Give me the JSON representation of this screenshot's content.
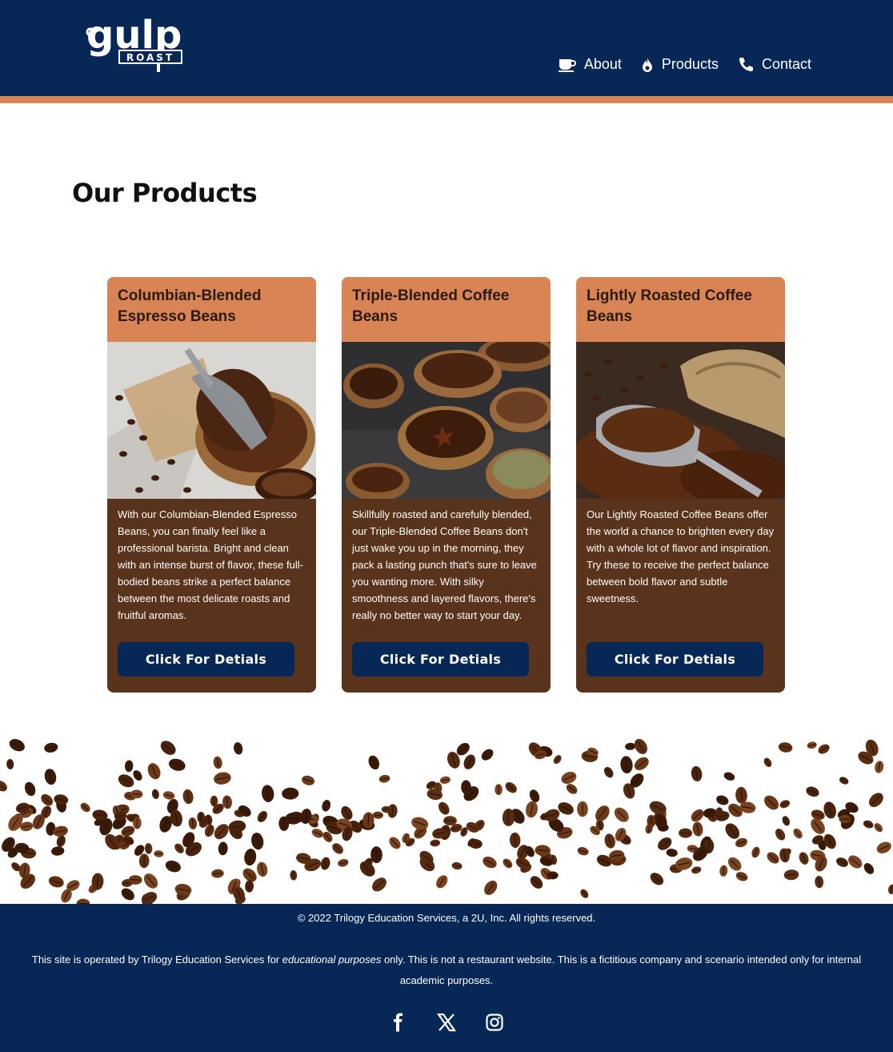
{
  "header": {
    "logo_text": "gulp",
    "logo_subtext": "ROAST",
    "nav": [
      {
        "label": "About",
        "icon": "coffee-cup-icon"
      },
      {
        "label": "Products",
        "icon": "flame-icon"
      },
      {
        "label": "Contact",
        "icon": "phone-icon"
      }
    ]
  },
  "main": {
    "title": "Our Products",
    "cards": [
      {
        "title": "Columbian-Blended Espresso Beans",
        "image": "coffee-beans-scoop-image",
        "description": "With our Columbian-Blended Espresso Beans, you can finally feel like a professional barista. Bright and clean with an intense burst of flavor, these full-bodied beans strike a perfect balance between the most delicate roasts and fruitful aromas.",
        "button": "Click For Detials"
      },
      {
        "title": "Triple-Blended Coffee Beans",
        "image": "coffee-bowls-image",
        "description": "Skillfully roasted and carefully blended, our Triple-Blended Coffee Beans don't just wake you up in the morning, they pack a lasting punch that's sure to leave you wanting more. With silky smoothness and layered flavors, there's really no better way to start your day.",
        "button": "Click For Detials"
      },
      {
        "title": "Lightly Roasted Coffee Beans",
        "image": "coffee-sack-scoop-image",
        "description": "Our Lightly Roasted Coffee Beans offer the world a chance to brighten every day with a whole lot of flavor and inspiration. Try these to receive the perfect balance between bold flavor and subtle sweetness.",
        "button": "Click For Detials"
      }
    ]
  },
  "footer": {
    "copyright": "© 2022 Trilogy Education Services, a 2U, Inc. All rights reserved.",
    "disclaimer_before": "This site is operated by Trilogy Education Services for ",
    "disclaimer_em": "educational purposes",
    "disclaimer_after": " only. This is not a restaurant website. This is a fictitious company and scenario intended only for internal academic purposes.",
    "socials": [
      "facebook-icon",
      "x-twitter-icon",
      "instagram-icon"
    ]
  },
  "colors": {
    "navy": "#072856",
    "orange": "#d98454",
    "brown": "#5a331d"
  }
}
